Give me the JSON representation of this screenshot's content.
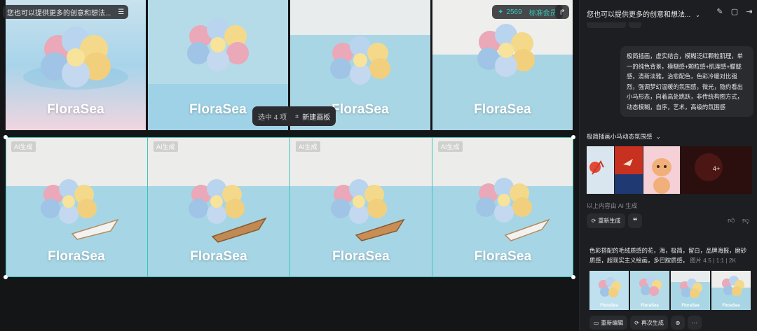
{
  "canvas": {
    "prompt_chip": "您也可以提供更多的创意和想法...",
    "credits": "2569",
    "vip_label": "标准会员",
    "selection_count": "选中 4 项",
    "new_board_label": "新建画板",
    "watermark": "FloraSea",
    "ai_tag": "AI生成",
    "row1_names": [
      "flower-image-1",
      "flower-image-2",
      "flower-image-3",
      "flower-image-4"
    ],
    "row2_names": [
      "flower-boat-image-1",
      "flower-boat-image-2",
      "flower-boat-image-3",
      "flower-boat-image-4"
    ]
  },
  "panel": {
    "title": "您也可以提供更多的创意和想法...",
    "user_prompt": "极简插画，虚实结合，模糊泛红颗粒肌理，单一的纯色背景，模糊感+颗粒感+肌理感+朦胧感，清新淡雅，治愈配色，色彩冷暖对比强烈，强调梦幻温暖的氛围感，微光，隐约看出小马形态，向着高处跳跃，非传统构图方式，动态模糊，自序，艺术，高级的氛围感",
    "result_title": "极简插画小马动态氛围感",
    "more_count": "4+",
    "ai_note": "以上内容由 AI 生成",
    "regenerate_label": "重新生成",
    "quote_icon": "quote-icon",
    "gen_prompt": "色彩搭配的毛绒质感的花，海，极简，留白，品牌海报，磨砂质感，超现实主义绘画，多巴胺质感，",
    "meta_type": "图片 4.5",
    "meta_ratio": "1:1",
    "meta_res": "2K",
    "actions": [
      "重新编辑",
      "再次生成"
    ],
    "thumb_label": "FloraSea"
  },
  "colors": {
    "accent": "#39c5bb",
    "bg": "#141517",
    "panel": "#1d1e21"
  }
}
